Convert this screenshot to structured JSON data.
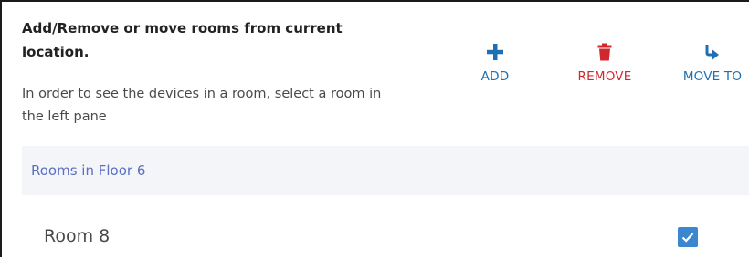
{
  "panel": {
    "heading": "Add/Remove or move rooms from current location.",
    "instructions": "In order to see the devices in a room, select a room in the left pane"
  },
  "actions": {
    "add_label": "ADD",
    "remove_label": "REMOVE",
    "move_label": "MOVE TO",
    "add_icon": "plus-icon",
    "remove_icon": "trash-icon",
    "move_icon": "move-arrow-icon"
  },
  "rooms": {
    "section_title": "Rooms in Floor 6",
    "items": [
      {
        "name": "Room 8",
        "checked": true
      }
    ]
  },
  "colors": {
    "primary_blue": "#1f6fb2",
    "danger_red": "#d0282e",
    "section_text": "#5a6fc0",
    "section_background": "#f4f5f9",
    "checkbox_blue": "#3a86cf"
  }
}
